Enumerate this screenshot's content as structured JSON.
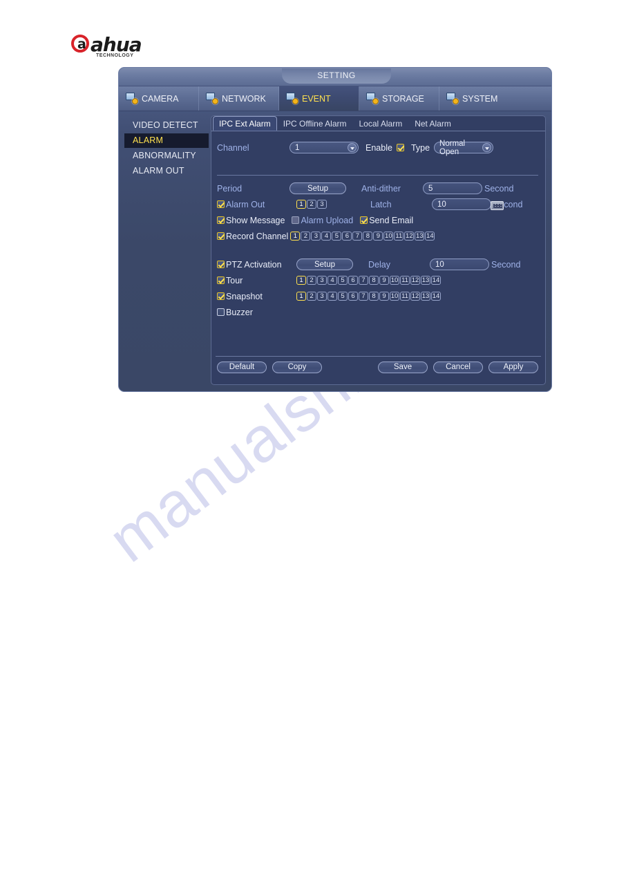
{
  "brand": {
    "name": "ahua",
    "letter": "a",
    "tagline": "TECHNOLOGY"
  },
  "watermark": {
    "text": "manualshive.com"
  },
  "window": {
    "title": "SETTING",
    "nav_tabs": [
      {
        "label": "CAMERA",
        "icon": "camera-gear-icon",
        "active": false
      },
      {
        "label": "NETWORK",
        "icon": "network-gear-icon",
        "active": false
      },
      {
        "label": "EVENT",
        "icon": "event-gear-icon",
        "active": true
      },
      {
        "label": "STORAGE",
        "icon": "storage-gear-icon",
        "active": false
      },
      {
        "label": "SYSTEM",
        "icon": "system-gear-icon",
        "active": false
      }
    ]
  },
  "sidebar": {
    "items": [
      {
        "label": "VIDEO DETECT",
        "active": false
      },
      {
        "label": "ALARM",
        "active": true
      },
      {
        "label": "ABNORMALITY",
        "active": false
      },
      {
        "label": "ALARM OUT",
        "active": false
      }
    ]
  },
  "inner_tabs": [
    {
      "label": "IPC Ext Alarm",
      "active": true
    },
    {
      "label": "IPC Offline Alarm",
      "active": false
    },
    {
      "label": "Local Alarm",
      "active": false
    },
    {
      "label": "Net Alarm",
      "active": false
    }
  ],
  "form": {
    "channel_label": "Channel",
    "channel_value": "1",
    "enable_label": "Enable",
    "enable_checked": true,
    "type_label": "Type",
    "type_value": "Normal Open",
    "period_label": "Period",
    "period_button": "Setup",
    "antidither_label": "Anti-dither",
    "antidither_value": "5",
    "antidither_unit": "Second",
    "alarm_out_label": "Alarm Out",
    "alarm_out_checked": true,
    "alarm_out_channels": [
      "1",
      "2",
      "3"
    ],
    "alarm_out_selected": [
      "1"
    ],
    "latch_label": "Latch",
    "latch_value": "10",
    "latch_unit": "Second",
    "show_message_label": "Show Message",
    "show_message_checked": true,
    "alarm_upload_label": "Alarm Upload",
    "alarm_upload_checked": false,
    "send_email_label": "Send Email",
    "send_email_checked": true,
    "record_channel_label": "Record Channel",
    "record_channel_checked": true,
    "record_channels": [
      "1",
      "2",
      "3",
      "4",
      "5",
      "6",
      "7",
      "8",
      "9",
      "10",
      "11",
      "12",
      "13",
      "14"
    ],
    "record_selected": [
      "1"
    ],
    "ptz_label": "PTZ Activation",
    "ptz_checked": true,
    "ptz_button": "Setup",
    "delay_label": "Delay",
    "delay_value": "10",
    "delay_unit": "Second",
    "tour_label": "Tour",
    "tour_checked": true,
    "tour_channels": [
      "1",
      "2",
      "3",
      "4",
      "5",
      "6",
      "7",
      "8",
      "9",
      "10",
      "11",
      "12",
      "13",
      "14"
    ],
    "tour_selected": [
      "1"
    ],
    "snapshot_label": "Snapshot",
    "snapshot_checked": true,
    "snapshot_channels": [
      "1",
      "2",
      "3",
      "4",
      "5",
      "6",
      "7",
      "8",
      "9",
      "10",
      "11",
      "12",
      "13",
      "14"
    ],
    "snapshot_selected": [
      "1"
    ],
    "buzzer_label": "Buzzer",
    "buzzer_checked": false
  },
  "footer": {
    "default_label": "Default",
    "copy_label": "Copy",
    "save_label": "Save",
    "cancel_label": "Cancel",
    "apply_label": "Apply"
  },
  "colors": {
    "accent_yellow": "#ffe14f",
    "panel_bg": "#323e63",
    "window_bg": "#3a4766",
    "label_blue": "#9fb2e8",
    "brand_red": "#d8232a"
  }
}
